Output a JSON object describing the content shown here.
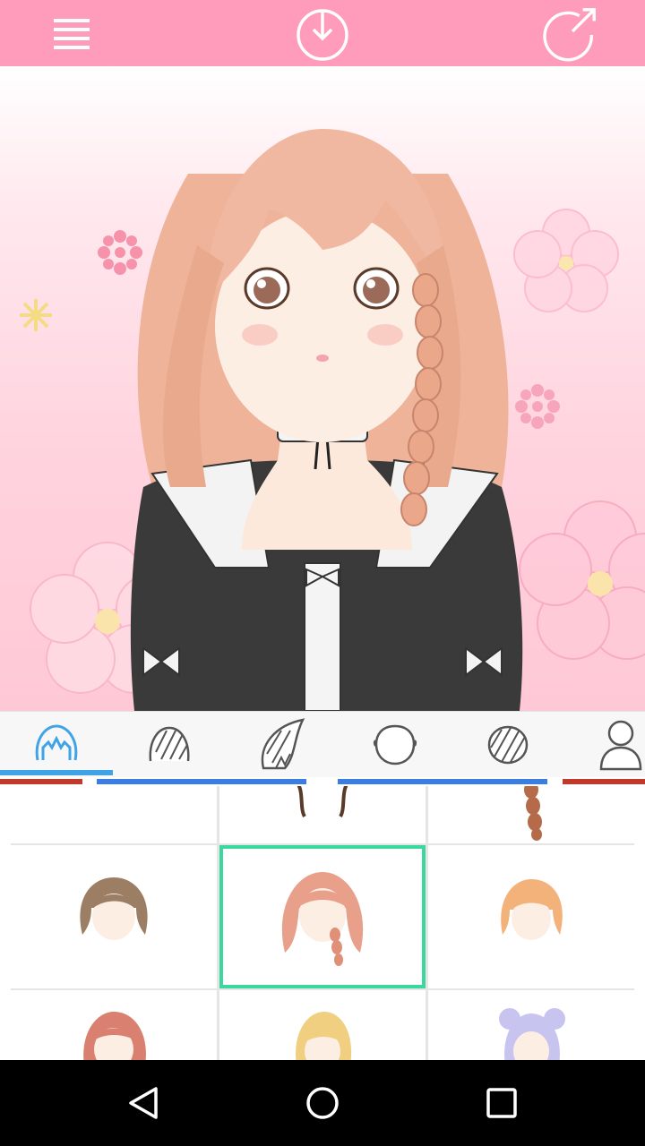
{
  "toolbar": {
    "menu_icon": "hamburger-menu-icon",
    "download_icon": "download-circle-icon",
    "share_icon": "share-arrow-circle-icon"
  },
  "colors": {
    "topbar": "#ff9cbc",
    "tab_active": "#3fa3e6",
    "selected_border": "#3ad79e",
    "strip_red": "#c0392b",
    "strip_blue": "#3b7ee0"
  },
  "tabs": [
    {
      "icon": "front-hair-icon",
      "active": true
    },
    {
      "icon": "back-hair-icon",
      "active": false
    },
    {
      "icon": "side-hair-icon",
      "active": false
    },
    {
      "icon": "face-shape-icon",
      "active": false
    },
    {
      "icon": "hair-pattern-icon",
      "active": false
    },
    {
      "icon": "body-silhouette-icon",
      "active": false
    }
  ],
  "hair_grid": {
    "selected_index": 4,
    "items": [
      {
        "name": "hairstyle-thumbnail",
        "color": "#d9b089"
      },
      {
        "name": "hairstyle-thumbnail",
        "color": "#5a3a2a"
      },
      {
        "name": "hairstyle-thumbnail",
        "color": "#b56a4a"
      },
      {
        "name": "hairstyle-thumbnail",
        "color": "#9b7e63"
      },
      {
        "name": "hairstyle-thumbnail",
        "color": "#e8a08a"
      },
      {
        "name": "hairstyle-thumbnail",
        "color": "#f2b27a"
      },
      {
        "name": "hairstyle-thumbnail",
        "color": "#d98070"
      },
      {
        "name": "hairstyle-thumbnail",
        "color": "#f0d080"
      },
      {
        "name": "hairstyle-thumbnail",
        "color": "#c8c4f0"
      }
    ]
  },
  "navbar": {
    "back_icon": "back-triangle-icon",
    "home_icon": "home-circle-icon",
    "recents_icon": "recents-square-icon"
  }
}
